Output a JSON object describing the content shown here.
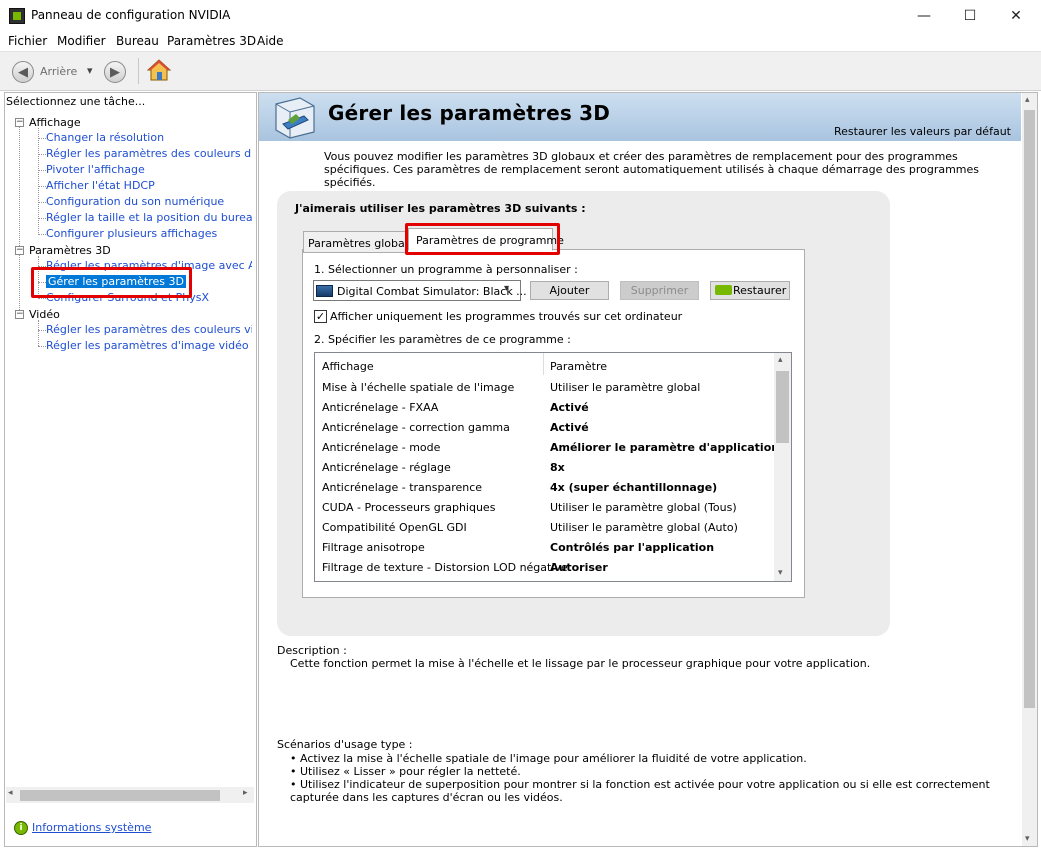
{
  "window": {
    "title": "Panneau de configuration NVIDIA",
    "minimize": "—",
    "maximize": "☐",
    "close": "✕"
  },
  "menu": [
    "Fichier",
    "Modifier",
    "Bureau",
    "Paramètres 3D",
    "Aide"
  ],
  "toolbar": {
    "back_label": "Arrière",
    "back_icon": "◀",
    "forward_icon": "▶",
    "dropdown_icon": "▾"
  },
  "left": {
    "header": "Sélectionnez une tâche...",
    "sections": [
      {
        "label": "Affichage",
        "toggle": "−",
        "items": [
          "Changer la résolution",
          "Régler les paramètres des couleurs du bureau",
          "Pivoter l'affichage",
          "Afficher l'état HDCP",
          "Configuration du son numérique",
          "Régler la taille et la position du bureau",
          "Configurer plusieurs affichages"
        ]
      },
      {
        "label": "Paramètres 3D",
        "toggle": "−",
        "items": [
          "Régler les paramètres d'image avec Aperçu",
          "Gérer les paramètres 3D",
          "Configurer Surround et PhysX"
        ]
      },
      {
        "label": "Vidéo",
        "toggle": "−",
        "items": [
          "Régler les paramètres des couleurs vidéo",
          "Régler les paramètres d'image vidéo"
        ]
      }
    ],
    "info_icon": "i",
    "info_link": "Informations système"
  },
  "right": {
    "title": "Gérer les paramètres 3D",
    "restore_defaults": "Restaurer les valeurs par défaut",
    "intro": "Vous pouvez modifier les paramètres 3D globaux et créer des paramètres de remplacement pour des programmes spécifiques. Ces paramètres de remplacement seront automatiquement utilisés à chaque démarrage des programmes spécifiés.",
    "group_title": "J'aimerais utiliser les paramètres 3D suivants :",
    "tabs": [
      "Paramètres globaux",
      "Paramètres de programme"
    ],
    "step1": "1. Sélectionner un programme à personnaliser :",
    "program": "Digital Combat Simulator: Black ...",
    "buttons": {
      "add": "Ajouter",
      "delete": "Supprimer",
      "restore": "Restaurer"
    },
    "checkbox_checked": "✓",
    "checkbox_label": "Afficher uniquement les programmes trouvés sur cet ordinateur",
    "step2": "2. Spécifier les paramètres de ce programme :",
    "table": {
      "headers": [
        "Affichage",
        "Paramètre"
      ],
      "rows": [
        {
          "feature": "Mise à l'échelle spatiale de l'image",
          "value": "Utiliser le paramètre global",
          "bold": false
        },
        {
          "feature": "Anticrénelage - FXAA",
          "value": "Activé",
          "bold": true
        },
        {
          "feature": "Anticrénelage - correction gamma",
          "value": "Activé",
          "bold": true
        },
        {
          "feature": "Anticrénelage - mode",
          "value": "Améliorer le paramètre d'application",
          "bold": true
        },
        {
          "feature": "Anticrénelage - réglage",
          "value": "8x",
          "bold": true
        },
        {
          "feature": "Anticrénelage - transparence",
          "value": "4x (super échantillonnage)",
          "bold": true
        },
        {
          "feature": "CUDA - Processeurs graphiques",
          "value": "Utiliser le paramètre global (Tous)",
          "bold": false
        },
        {
          "feature": "Compatibilité OpenGL GDI",
          "value": "Utiliser le paramètre global (Auto)",
          "bold": false
        },
        {
          "feature": "Filtrage anisotrope",
          "value": "Contrôlés par l'application",
          "bold": true
        },
        {
          "feature": "Filtrage de texture - Distorsion LOD négative",
          "value": "Autoriser",
          "bold": true
        }
      ],
      "scroll_up": "▴",
      "scroll_down": "▾"
    },
    "description_label": "Description :",
    "description": "Cette fonction permet la mise à l'échelle et le lissage par le processeur graphique pour votre application.",
    "usage_label": "Scénarios d'usage type :",
    "usage": [
      "• Activez la mise à l'échelle spatiale de l'image pour améliorer la fluidité de votre application.",
      "• Utilisez « Lisser » pour régler la netteté.",
      "• Utilisez l'indicateur de superposition pour montrer si la fonction est activée pour votre application ou si elle est correctement",
      "capturée dans les captures d'écran ou les vidéos."
    ],
    "scroll_up": "▴",
    "scroll_down": "▾"
  },
  "colors": {
    "accent_red": "#e30000",
    "selection": "#0078d7",
    "nvidia_green": "#76b900",
    "link": "#1f4fd1"
  }
}
